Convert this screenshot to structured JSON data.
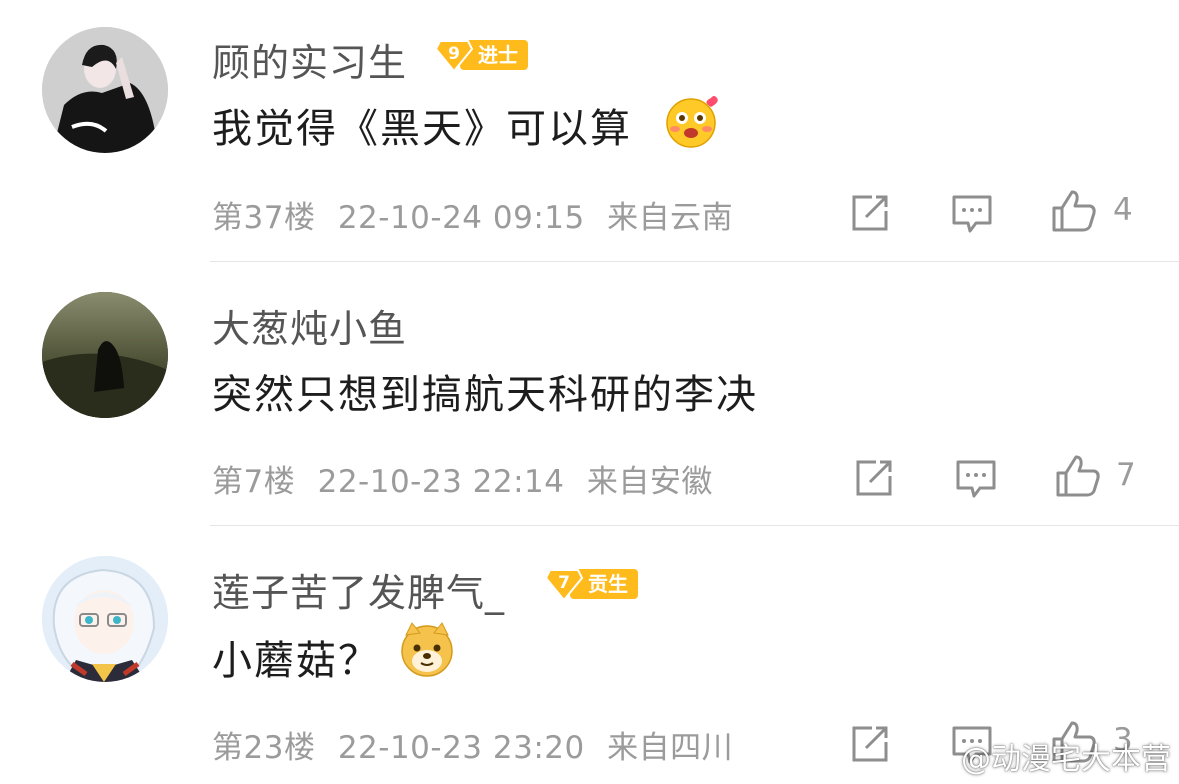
{
  "comments": [
    {
      "username": "顾的实习生",
      "badge": {
        "level": "9",
        "title": "进士"
      },
      "text": "我觉得《黑天》可以算",
      "emoji": "blushing-face-emoji",
      "floor": "第37楼",
      "datetime": "22-10-24 09:15",
      "location": "来自云南",
      "likes": "4"
    },
    {
      "username": "大葱炖小鱼",
      "text": "突然只想到搞航天科研的李决",
      "floor": "第7楼",
      "datetime": "22-10-23 22:14",
      "location": "来自安徽",
      "likes": "7"
    },
    {
      "username": "莲子苦了发脾气_",
      "badge": {
        "level": "7",
        "title": "贡生"
      },
      "text": "小蘑菇？",
      "emoji": "doge-emoji",
      "floor": "第23楼",
      "datetime": "22-10-23 23:20",
      "location": "来自四川",
      "likes": "3"
    }
  ],
  "watermark": "@动漫宅大本营",
  "colors": {
    "badge": "#ffbb1c",
    "meta": "#9b9b9b",
    "divider": "#e6e6e6"
  }
}
